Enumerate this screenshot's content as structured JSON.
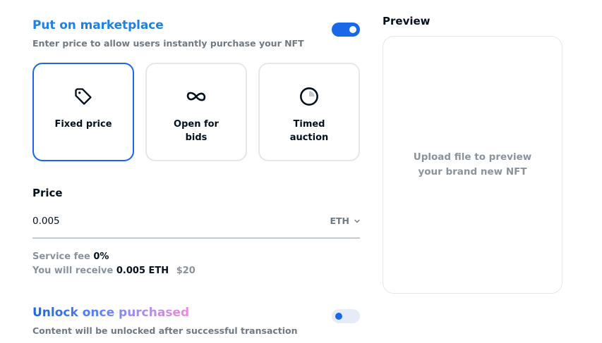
{
  "marketplace": {
    "title": "Put on marketplace",
    "subtitle": "Enter price to allow users instantly purchase your NFT",
    "toggle_on": true
  },
  "sale_types": [
    {
      "label": "Fixed price",
      "icon": "price-tag-icon",
      "selected": true
    },
    {
      "label": "Open for bids",
      "icon": "infinity-icon",
      "selected": false
    },
    {
      "label": "Timed auction",
      "icon": "timer-icon",
      "selected": false
    }
  ],
  "price": {
    "label": "Price",
    "value": "0.005",
    "currency": "ETH"
  },
  "fees": {
    "service_fee_label": "Service fee",
    "service_fee_value": "0%",
    "receive_label": "You will receive",
    "receive_value": "0.005 ETH",
    "receive_usd": "$20"
  },
  "unlock": {
    "title": "Unlock once purchased",
    "subtitle": "Content will be unlocked after successful transaction",
    "toggle_on": false
  },
  "preview": {
    "title": "Preview",
    "placeholder": "Upload file to preview your brand new NFT"
  },
  "colors": {
    "accent": "#2081e2",
    "toggle_active": "#1868e8",
    "muted_text": "#707a83"
  }
}
